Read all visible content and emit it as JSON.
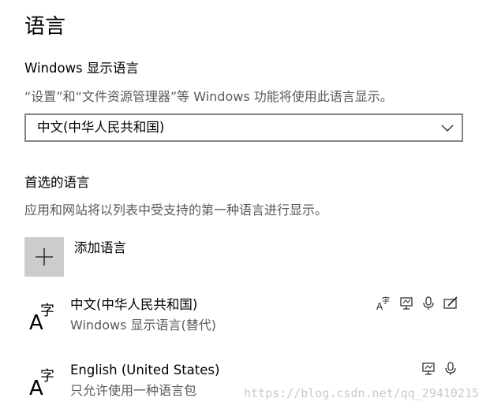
{
  "page": {
    "title": "语言"
  },
  "display_language": {
    "title": "Windows 显示语言",
    "description": "“设置”和“文件资源管理器”等 Windows 功能将使用此语言显示。",
    "selected": "中文(中华人民共和国)"
  },
  "preferred_languages": {
    "title": "首选的语言",
    "description": "应用和网站将以列表中受支持的第一种语言进行显示。",
    "add_label": "添加语言",
    "items": [
      {
        "name": "中文(中华人民共和国)",
        "subtitle": "Windows 显示语言(替代)",
        "features": [
          "language-pack-icon",
          "text-to-speech-icon",
          "speech-recognition-icon",
          "handwriting-icon"
        ]
      },
      {
        "name": "English (United States)",
        "subtitle": "只允许使用一种语言包",
        "features": [
          "text-to-speech-icon",
          "speech-recognition-icon"
        ]
      }
    ]
  },
  "watermark": "https://blog.csdn.net/qq_29410215"
}
